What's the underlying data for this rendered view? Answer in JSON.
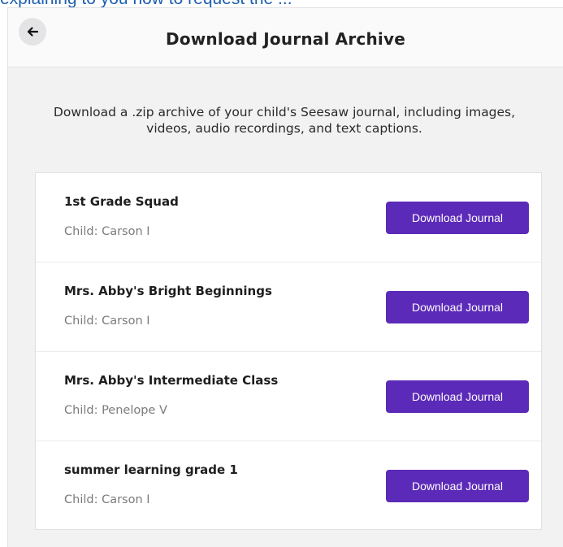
{
  "top_fragment": "explaining to you how to request the ... ",
  "header": {
    "back_icon": "arrow-left-icon",
    "title": "Download Journal Archive"
  },
  "description": "Download a .zip archive of your child's Seesaw journal, including images, videos, audio recordings, and text captions.",
  "journals": [
    {
      "class_name": "1st Grade Squad",
      "child": "Child: Carson I",
      "button_label": "Download Journal"
    },
    {
      "class_name": "Mrs. Abby's Bright Beginnings",
      "child": "Child: Carson I",
      "button_label": "Download Journal"
    },
    {
      "class_name": "Mrs. Abby's Intermediate Class",
      "child": "Child: Penelope V",
      "button_label": "Download Journal"
    },
    {
      "class_name": "summer learning grade 1",
      "child": "Child: Carson I",
      "button_label": "Download Journal"
    }
  ],
  "colors": {
    "accent": "#5c2ab8",
    "panel_background": "#f2f2f2",
    "header_background": "#fafafa"
  }
}
